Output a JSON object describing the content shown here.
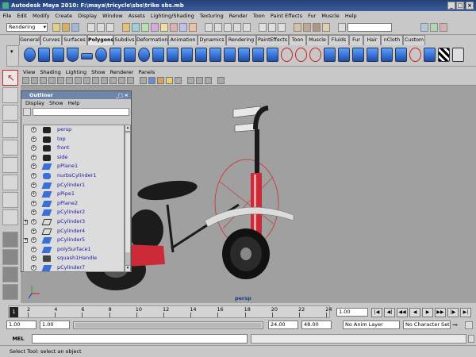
{
  "window": {
    "title": "Autodesk Maya 2010: F:\\maya\\tricycle\\sbs\\trike sbs.mb"
  },
  "menubar": [
    "File",
    "Edit",
    "Modify",
    "Create",
    "Display",
    "Window",
    "Assets",
    "Lighting/Shading",
    "Texturing",
    "Render",
    "Toon",
    "Paint Effects",
    "Fur",
    "Muscle",
    "Help"
  ],
  "statusline": {
    "menu_set": "Rendering"
  },
  "shelf": {
    "tabs": [
      "General",
      "Curves",
      "Surfaces",
      "Polygons",
      "Subdivs",
      "Deformation",
      "Animation",
      "Dynamics",
      "Rendering",
      "PaintEffects",
      "Toon",
      "Muscle",
      "Fluids",
      "Fur",
      "Hair",
      "nCloth",
      "Custom"
    ],
    "active_tab": "Polygons"
  },
  "viewport": {
    "menu": [
      "View",
      "Shading",
      "Lighting",
      "Show",
      "Renderer",
      "Panels"
    ],
    "camera_label": "persp",
    "colors": {
      "bg": "#a0a0a0",
      "seat": "#1a1a1a",
      "frame": "#cc2a36",
      "fender": "#dcdcdc"
    }
  },
  "outliner": {
    "title": "Outliner",
    "menu": [
      "Display",
      "Show",
      "Help"
    ],
    "items": [
      {
        "label": "persp",
        "icon": "camera-icon",
        "expander": false
      },
      {
        "label": "top",
        "icon": "camera-icon",
        "expander": false
      },
      {
        "label": "front",
        "icon": "camera-icon",
        "expander": false
      },
      {
        "label": "side",
        "icon": "camera-icon",
        "expander": false
      },
      {
        "label": "pPlane1",
        "icon": "mesh-icon",
        "expander": false
      },
      {
        "label": "nurbsCylinder1",
        "icon": "nurbs-icon",
        "expander": false
      },
      {
        "label": "pCylinder1",
        "icon": "mesh-icon",
        "expander": false
      },
      {
        "label": "pPipe1",
        "icon": "mesh-icon",
        "expander": false
      },
      {
        "label": "pPlane2",
        "icon": "mesh-icon",
        "expander": false
      },
      {
        "label": "pCylinder2",
        "icon": "mesh-icon",
        "expander": false
      },
      {
        "label": "pCylinder3",
        "icon": "curve-icon",
        "expander": true
      },
      {
        "label": "pCylinder4",
        "icon": "curve-icon",
        "expander": false
      },
      {
        "label": "pCylinder5",
        "icon": "mesh-icon",
        "expander": true
      },
      {
        "label": "polySurface1",
        "icon": "mesh-icon",
        "expander": false
      },
      {
        "label": "squash1Handle",
        "icon": "deformer-icon",
        "expander": false
      },
      {
        "label": "pCylinder7",
        "icon": "mesh-icon",
        "expander": false
      }
    ]
  },
  "timeline": {
    "ticks": [
      "2",
      "4",
      "6",
      "8",
      "10",
      "12",
      "14",
      "16",
      "18",
      "20",
      "22",
      "24"
    ],
    "current_frame_marker": "1",
    "current_time": "1.00"
  },
  "rangebar": {
    "start_time": "1.00",
    "range_start": "1.00",
    "range_end": "24.00",
    "end_time": "48.00",
    "anim_layer": "No Anim Layer",
    "character_set": "No Character Set"
  },
  "commandline": {
    "label": "MEL"
  },
  "helpline": {
    "text": "Select Tool: select an object"
  }
}
